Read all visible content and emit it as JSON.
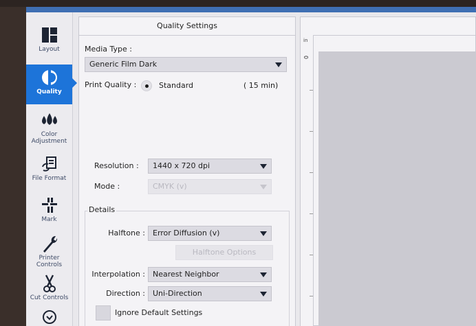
{
  "sidebar": {
    "items": [
      {
        "label": "Layout",
        "icon": "layout-icon"
      },
      {
        "label": "Quality",
        "icon": "quality-icon",
        "active": true
      },
      {
        "label": "Color Adjustment",
        "icon": "droplets-icon"
      },
      {
        "label": "File Format",
        "icon": "file-format-icon"
      },
      {
        "label": "Mark",
        "icon": "crop-mark-icon"
      },
      {
        "label": "Printer Controls",
        "icon": "wrench-icon"
      },
      {
        "label": "Cut Controls",
        "icon": "scissors-icon"
      },
      {
        "label": "",
        "icon": "clock-icon"
      }
    ]
  },
  "panel": {
    "title": "Quality Settings",
    "media_type_label": "Media Type :",
    "media_type_value": "Generic Film Dark",
    "print_quality_label": "Print Quality :",
    "print_quality_value": "Standard",
    "print_quality_time": "( 15 min)",
    "resolution_label": "Resolution :",
    "resolution_value": "1440 x 720 dpi",
    "mode_label": "Mode :",
    "mode_value": "CMYK (v)",
    "details_label": "Details",
    "halftone_label": "Halftone :",
    "halftone_value": "Error Diffusion (v)",
    "halftone_options_label": "Halftone Options",
    "interpolation_label": "Interpolation :",
    "interpolation_value": "Nearest Neighbor",
    "direction_label": "Direction :",
    "direction_value": "Uni-Direction",
    "ignore_defaults_label": "Ignore Default Settings"
  },
  "preview": {
    "ruler_unit": "in",
    "ruler_zero": "0"
  },
  "colors": {
    "accent": "#1d74d9",
    "title_strip": "#3f6fb3",
    "icon_dark": "#1d2433"
  }
}
